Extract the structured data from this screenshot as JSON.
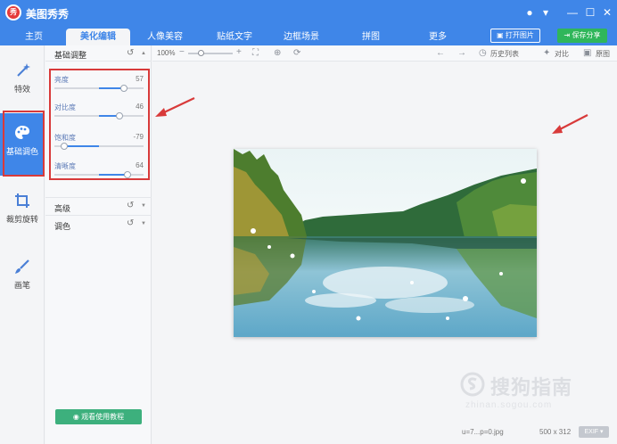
{
  "app": {
    "title": "美图秀秀",
    "logo_text": "秀"
  },
  "window_controls": [
    "message-icon",
    "dropdown-icon",
    "minimize-icon",
    "maximize-icon",
    "close-icon"
  ],
  "nav": {
    "tabs": [
      {
        "label": "主页",
        "active": false
      },
      {
        "label": "美化编辑",
        "active": true
      },
      {
        "label": "人像美容",
        "active": false
      },
      {
        "label": "贴纸文字",
        "active": false
      },
      {
        "label": "边框场景",
        "active": false
      },
      {
        "label": "拼图",
        "active": false
      },
      {
        "label": "更多",
        "active": false
      }
    ],
    "open_label": "打开图片",
    "share_label": "保存分享"
  },
  "rail": {
    "items": [
      {
        "label": "特效",
        "icon": "magic-wand-icon",
        "active": false
      },
      {
        "label": "基础调色",
        "icon": "palette-icon",
        "active": true
      },
      {
        "label": "裁剪旋转",
        "icon": "crop-icon",
        "active": false
      },
      {
        "label": "画笔",
        "icon": "brush-icon",
        "active": false
      }
    ]
  },
  "panel": {
    "title": "基础调整",
    "sliders": [
      {
        "label": "亮度",
        "value": "57",
        "level": 0.78
      },
      {
        "label": "对比度",
        "value": "46",
        "level": 0.73
      },
      {
        "label": "饱和度",
        "value": "-79",
        "level": 0.11
      },
      {
        "label": "清晰度",
        "value": "64",
        "level": 0.82
      }
    ],
    "sections": [
      {
        "label": "高级"
      },
      {
        "label": "调色"
      }
    ],
    "tutorial_label": "观看使用教程"
  },
  "toolbar": {
    "zoom": "100%",
    "history_label": "历史列表",
    "compare_label": "对比",
    "original_label": "原图"
  },
  "status": {
    "filename": "u=7...p=0.jpg",
    "dimensions": "500 x 312",
    "exif_label": "EXIF"
  },
  "watermark": {
    "text": "搜狗指南",
    "url": "zhinan.sogou.com"
  },
  "colors": {
    "accent": "#3f86e8",
    "share": "#2fb65a",
    "highlight": "#d83a3a"
  }
}
